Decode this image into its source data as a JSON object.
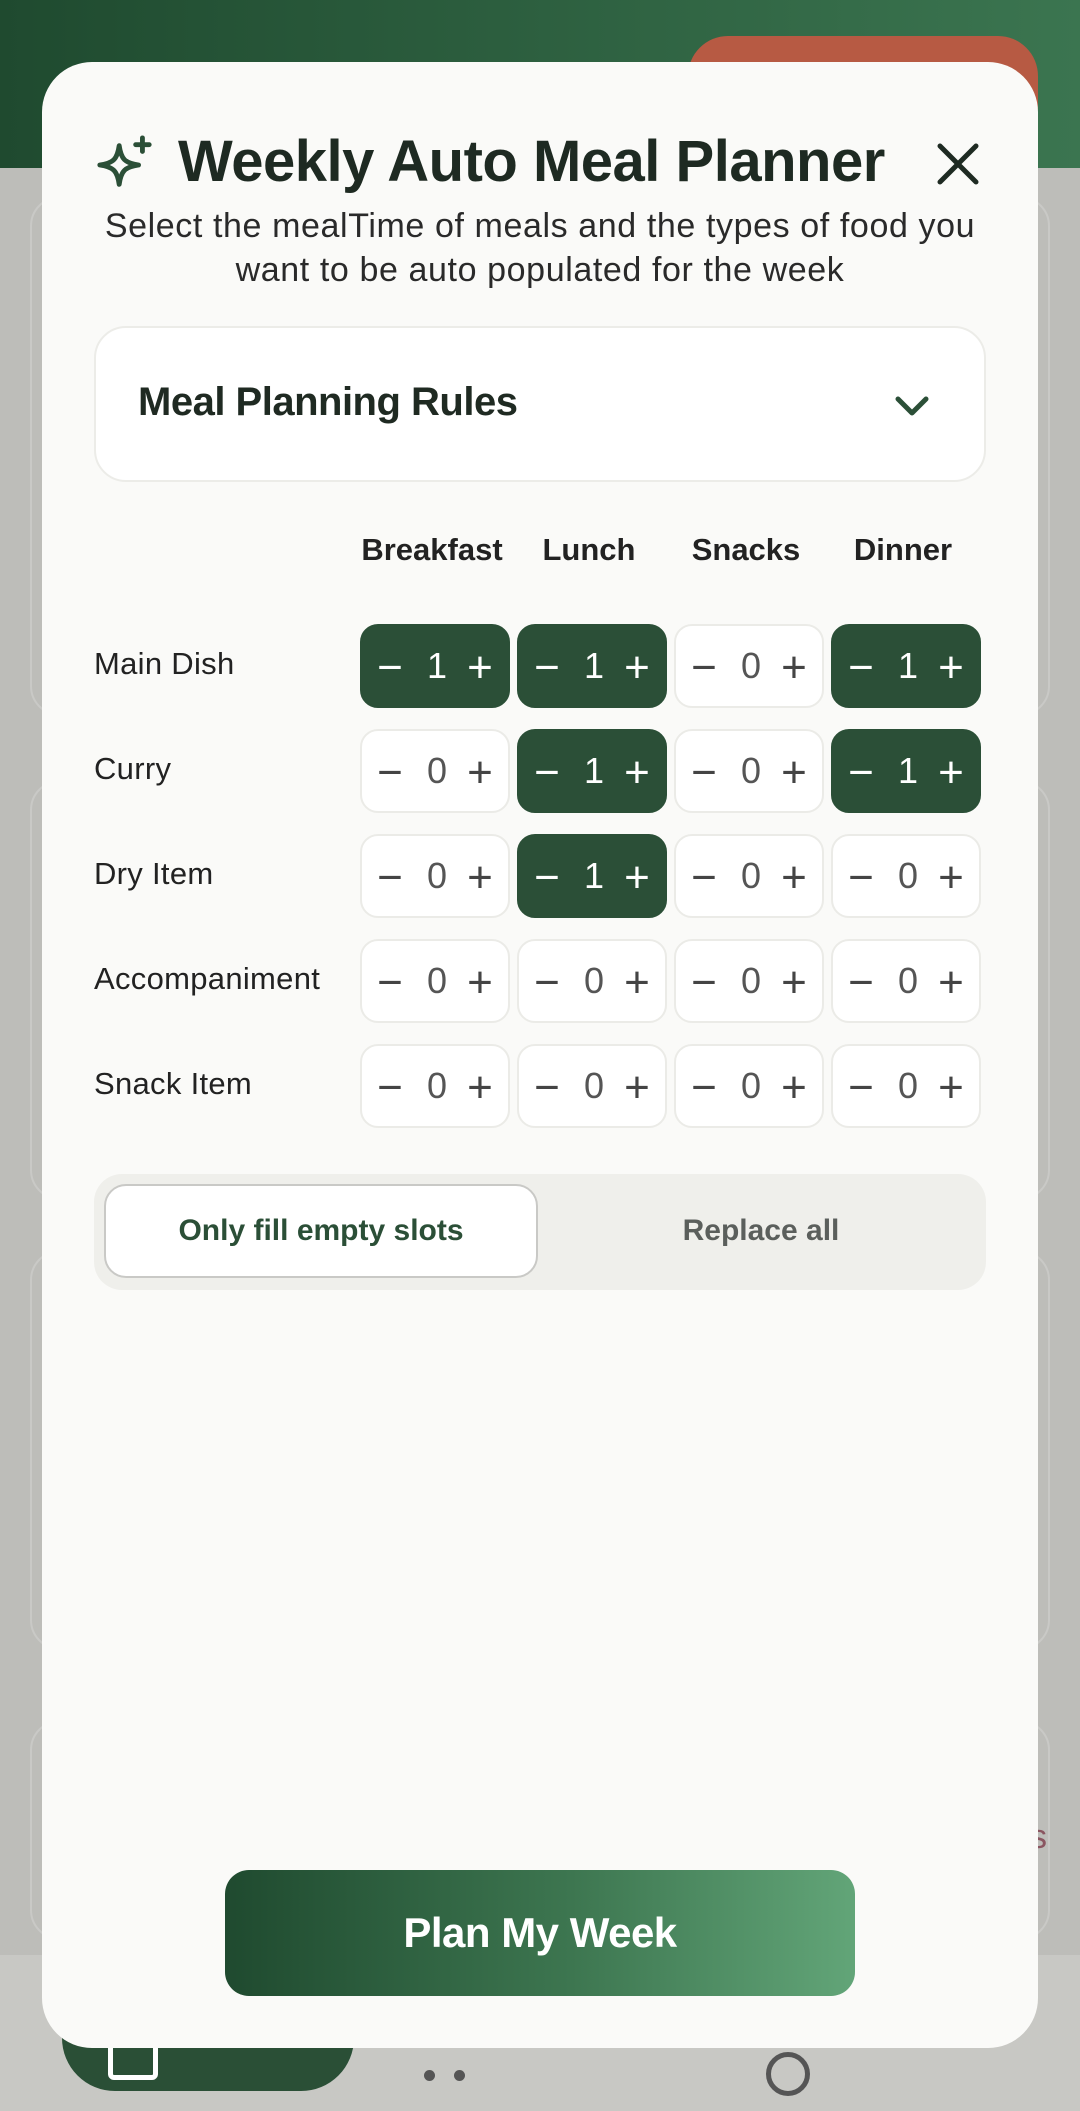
{
  "modal": {
    "title": "Weekly Auto Meal Planner",
    "subtitle": "Select the mealTime of meals and the types of food you want to be auto populated for the week",
    "rules_label": "Meal Planning Rules",
    "icons": {
      "title": "sparkle-icon",
      "close": "close-icon",
      "rules": "chevron-down-icon"
    }
  },
  "grid": {
    "columns": [
      "Breakfast",
      "Lunch",
      "Snacks",
      "Dinner"
    ],
    "rows": [
      {
        "label": "Main Dish",
        "values": [
          "1",
          "1",
          "0",
          "1"
        ]
      },
      {
        "label": "Curry",
        "values": [
          "0",
          "1",
          "0",
          "1"
        ]
      },
      {
        "label": "Dry Item",
        "values": [
          "0",
          "1",
          "0",
          "0"
        ]
      },
      {
        "label": "Accompaniment",
        "values": [
          "0",
          "0",
          "0",
          "0"
        ]
      },
      {
        "label": "Snack Item",
        "values": [
          "0",
          "0",
          "0",
          "0"
        ]
      }
    ],
    "minus_symbol": "−",
    "plus_symbol": "+"
  },
  "mode": {
    "options": [
      "Only fill empty slots",
      "Replace all"
    ],
    "selected": "Only fill empty slots"
  },
  "actions": {
    "plan_label": "Plan My Week"
  },
  "colors": {
    "primary": "#2b4f37",
    "accent": "#b75a43",
    "surface": "#fafaf8"
  }
}
